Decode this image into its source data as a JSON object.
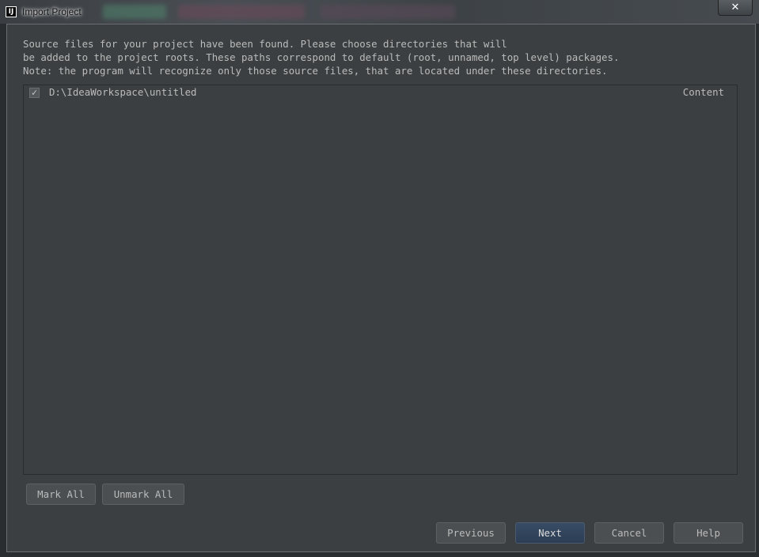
{
  "window": {
    "title": "Import Project",
    "close_label": "✕"
  },
  "description": [
    "Source files for your project have been found. Please choose directories that will",
    "be added to the project roots. These paths correspond to default (root, unnamed, top level) packages.",
    "Note: the program will recognize only those source files, that are located under these directories."
  ],
  "roots": [
    {
      "path": "D:\\IdeaWorkspace\\untitled",
      "type": "Content",
      "checked": true
    }
  ],
  "buttons": {
    "mark_all": "Mark All",
    "unmark_all": "Unmark All",
    "previous": "Previous",
    "next": "Next",
    "cancel": "Cancel",
    "help": "Help"
  },
  "colors": {
    "background": "#3c3f41",
    "text": "#bbbbbb",
    "primary_button": "#344760"
  }
}
